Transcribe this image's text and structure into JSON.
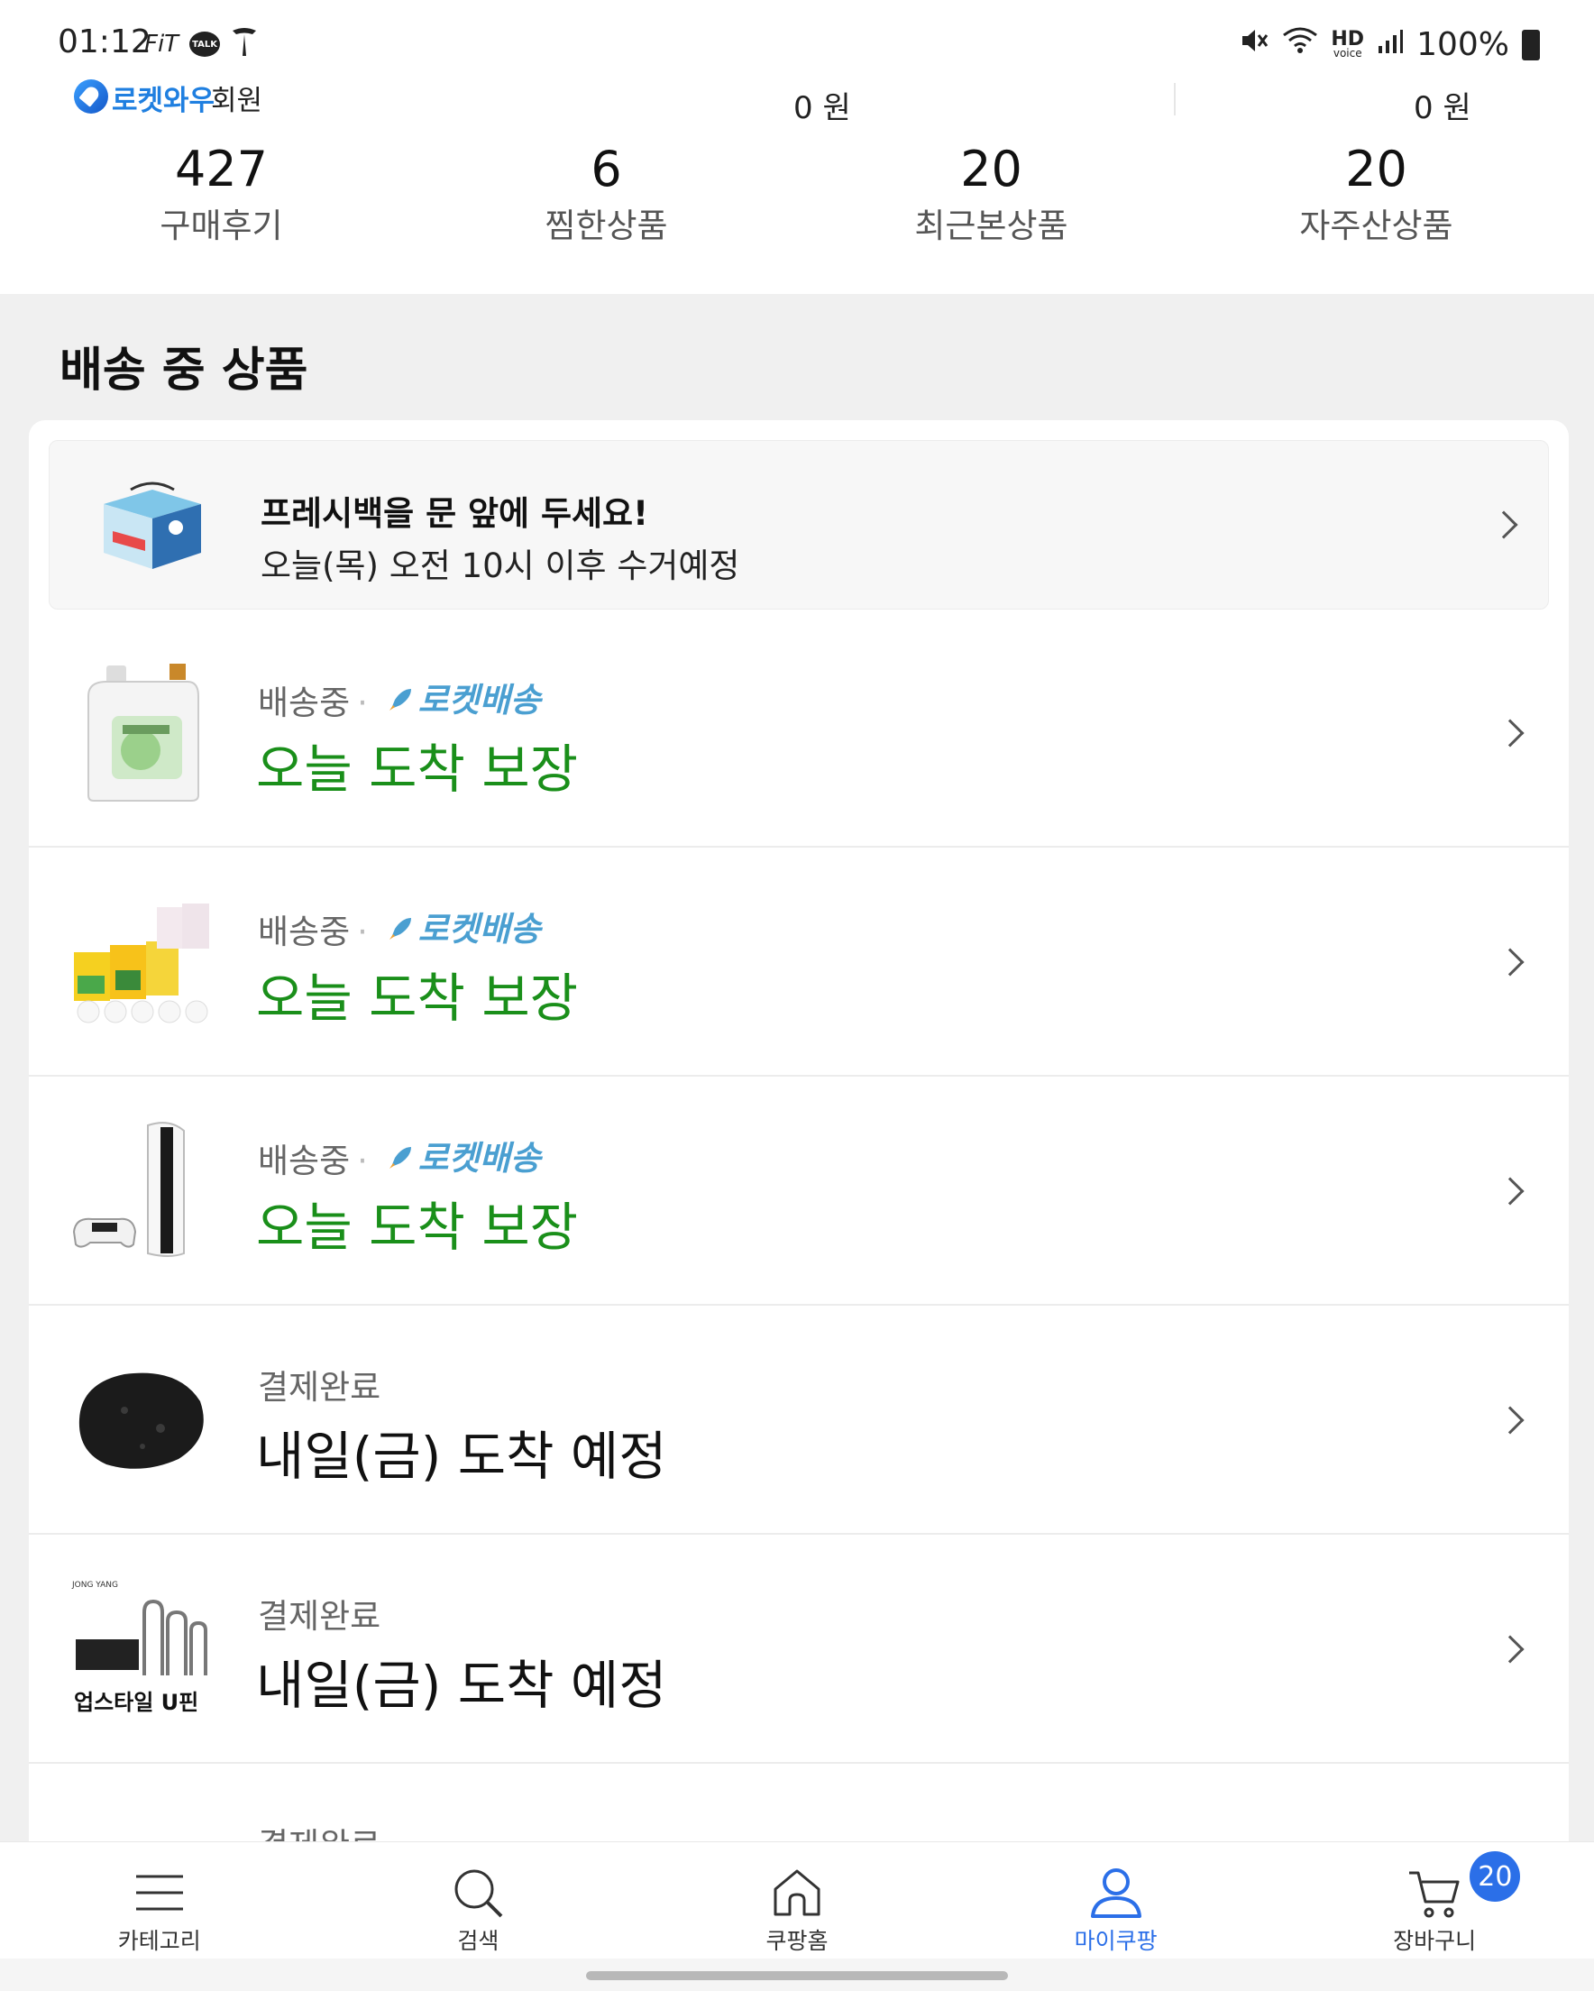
{
  "status_bar": {
    "time": "01:12",
    "left_icons": [
      "fit-icon",
      "kakaotalk-icon",
      "tesla-icon"
    ],
    "talk_badge": "TALK",
    "fit_text": "FiT",
    "right_icons": [
      "mute-icon",
      "wifi-icon",
      "hd-voice-icon",
      "signal-icon",
      "battery-icon"
    ],
    "hd_text": "HD",
    "voice_text": "voice",
    "battery": "100%"
  },
  "member": {
    "badge": "로켓와우",
    "suffix": "회원",
    "cash_a": "0 원",
    "cash_b": "0 원"
  },
  "counts": [
    {
      "value": "427",
      "label": "구매후기"
    },
    {
      "value": "6",
      "label": "찜한상품"
    },
    {
      "value": "20",
      "label": "최근본상품"
    },
    {
      "value": "20",
      "label": "자주산상품"
    }
  ],
  "section_title": "배송 중 상품",
  "fresh_banner": {
    "title": "프레시백을 문 앞에 두세요!",
    "subtitle": "오늘(목) 오전 10시 이후 수거예정"
  },
  "orders": [
    {
      "status": "배송중",
      "rocket": "로켓배송",
      "eta": "오늘 도착 보장",
      "eta_color": "#1a8f1a",
      "thumb": "detergent-image"
    },
    {
      "status": "배송중",
      "rocket": "로켓배송",
      "eta": "오늘 도착 보장",
      "eta_color": "#1a8f1a",
      "thumb": "snack-boxes-image"
    },
    {
      "status": "배송중",
      "rocket": "로켓배송",
      "eta": "오늘 도착 보장",
      "eta_color": "#1a8f1a",
      "thumb": "game-console-image"
    },
    {
      "status": "결제완료",
      "rocket": "",
      "eta": "내일(금) 도착 예정",
      "eta_color": "#111111",
      "thumb": "black-sponge-image"
    },
    {
      "status": "결제완료",
      "rocket": "",
      "eta": "내일(금) 도착 예정",
      "eta_color": "#111111",
      "thumb": "u-pin-image",
      "thumb_text": "업스타일 U핀",
      "thumb_brand": "JONG YANG"
    },
    {
      "status": "결제완료",
      "rocket": "",
      "eta": "",
      "eta_color": "#111111",
      "thumb": "bottles-image"
    }
  ],
  "bottom_nav": [
    {
      "label": "카테고리",
      "icon": "menu-icon",
      "active": false
    },
    {
      "label": "검색",
      "icon": "search-icon",
      "active": false
    },
    {
      "label": "쿠팡홈",
      "icon": "home-icon",
      "active": false
    },
    {
      "label": "마이쿠팡",
      "icon": "person-icon",
      "active": true
    },
    {
      "label": "장바구니",
      "icon": "cart-icon",
      "active": false,
      "badge": "20"
    }
  ],
  "colors": {
    "accent_blue": "#2b6fe8",
    "eta_green": "#1a8f1a",
    "rocket_blue": "#4a9fd1"
  }
}
